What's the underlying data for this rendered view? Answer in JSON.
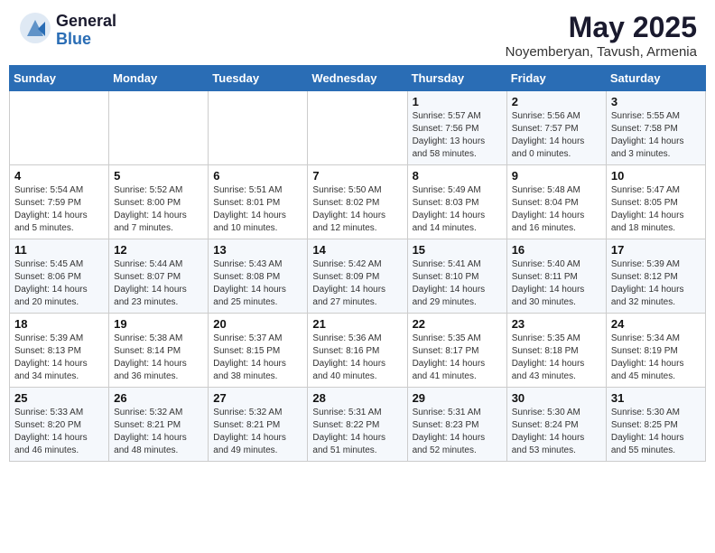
{
  "header": {
    "logo_general": "General",
    "logo_blue": "Blue",
    "title": "May 2025",
    "subtitle": "Noyemberyan, Tavush, Armenia"
  },
  "weekdays": [
    "Sunday",
    "Monday",
    "Tuesday",
    "Wednesday",
    "Thursday",
    "Friday",
    "Saturday"
  ],
  "weeks": [
    [
      {
        "day": "",
        "sunrise": "",
        "sunset": "",
        "daylight": ""
      },
      {
        "day": "",
        "sunrise": "",
        "sunset": "",
        "daylight": ""
      },
      {
        "day": "",
        "sunrise": "",
        "sunset": "",
        "daylight": ""
      },
      {
        "day": "",
        "sunrise": "",
        "sunset": "",
        "daylight": ""
      },
      {
        "day": "1",
        "sunrise": "Sunrise: 5:57 AM",
        "sunset": "Sunset: 7:56 PM",
        "daylight": "Daylight: 13 hours and 58 minutes."
      },
      {
        "day": "2",
        "sunrise": "Sunrise: 5:56 AM",
        "sunset": "Sunset: 7:57 PM",
        "daylight": "Daylight: 14 hours and 0 minutes."
      },
      {
        "day": "3",
        "sunrise": "Sunrise: 5:55 AM",
        "sunset": "Sunset: 7:58 PM",
        "daylight": "Daylight: 14 hours and 3 minutes."
      }
    ],
    [
      {
        "day": "4",
        "sunrise": "Sunrise: 5:54 AM",
        "sunset": "Sunset: 7:59 PM",
        "daylight": "Daylight: 14 hours and 5 minutes."
      },
      {
        "day": "5",
        "sunrise": "Sunrise: 5:52 AM",
        "sunset": "Sunset: 8:00 PM",
        "daylight": "Daylight: 14 hours and 7 minutes."
      },
      {
        "day": "6",
        "sunrise": "Sunrise: 5:51 AM",
        "sunset": "Sunset: 8:01 PM",
        "daylight": "Daylight: 14 hours and 10 minutes."
      },
      {
        "day": "7",
        "sunrise": "Sunrise: 5:50 AM",
        "sunset": "Sunset: 8:02 PM",
        "daylight": "Daylight: 14 hours and 12 minutes."
      },
      {
        "day": "8",
        "sunrise": "Sunrise: 5:49 AM",
        "sunset": "Sunset: 8:03 PM",
        "daylight": "Daylight: 14 hours and 14 minutes."
      },
      {
        "day": "9",
        "sunrise": "Sunrise: 5:48 AM",
        "sunset": "Sunset: 8:04 PM",
        "daylight": "Daylight: 14 hours and 16 minutes."
      },
      {
        "day": "10",
        "sunrise": "Sunrise: 5:47 AM",
        "sunset": "Sunset: 8:05 PM",
        "daylight": "Daylight: 14 hours and 18 minutes."
      }
    ],
    [
      {
        "day": "11",
        "sunrise": "Sunrise: 5:45 AM",
        "sunset": "Sunset: 8:06 PM",
        "daylight": "Daylight: 14 hours and 20 minutes."
      },
      {
        "day": "12",
        "sunrise": "Sunrise: 5:44 AM",
        "sunset": "Sunset: 8:07 PM",
        "daylight": "Daylight: 14 hours and 23 minutes."
      },
      {
        "day": "13",
        "sunrise": "Sunrise: 5:43 AM",
        "sunset": "Sunset: 8:08 PM",
        "daylight": "Daylight: 14 hours and 25 minutes."
      },
      {
        "day": "14",
        "sunrise": "Sunrise: 5:42 AM",
        "sunset": "Sunset: 8:09 PM",
        "daylight": "Daylight: 14 hours and 27 minutes."
      },
      {
        "day": "15",
        "sunrise": "Sunrise: 5:41 AM",
        "sunset": "Sunset: 8:10 PM",
        "daylight": "Daylight: 14 hours and 29 minutes."
      },
      {
        "day": "16",
        "sunrise": "Sunrise: 5:40 AM",
        "sunset": "Sunset: 8:11 PM",
        "daylight": "Daylight: 14 hours and 30 minutes."
      },
      {
        "day": "17",
        "sunrise": "Sunrise: 5:39 AM",
        "sunset": "Sunset: 8:12 PM",
        "daylight": "Daylight: 14 hours and 32 minutes."
      }
    ],
    [
      {
        "day": "18",
        "sunrise": "Sunrise: 5:39 AM",
        "sunset": "Sunset: 8:13 PM",
        "daylight": "Daylight: 14 hours and 34 minutes."
      },
      {
        "day": "19",
        "sunrise": "Sunrise: 5:38 AM",
        "sunset": "Sunset: 8:14 PM",
        "daylight": "Daylight: 14 hours and 36 minutes."
      },
      {
        "day": "20",
        "sunrise": "Sunrise: 5:37 AM",
        "sunset": "Sunset: 8:15 PM",
        "daylight": "Daylight: 14 hours and 38 minutes."
      },
      {
        "day": "21",
        "sunrise": "Sunrise: 5:36 AM",
        "sunset": "Sunset: 8:16 PM",
        "daylight": "Daylight: 14 hours and 40 minutes."
      },
      {
        "day": "22",
        "sunrise": "Sunrise: 5:35 AM",
        "sunset": "Sunset: 8:17 PM",
        "daylight": "Daylight: 14 hours and 41 minutes."
      },
      {
        "day": "23",
        "sunrise": "Sunrise: 5:35 AM",
        "sunset": "Sunset: 8:18 PM",
        "daylight": "Daylight: 14 hours and 43 minutes."
      },
      {
        "day": "24",
        "sunrise": "Sunrise: 5:34 AM",
        "sunset": "Sunset: 8:19 PM",
        "daylight": "Daylight: 14 hours and 45 minutes."
      }
    ],
    [
      {
        "day": "25",
        "sunrise": "Sunrise: 5:33 AM",
        "sunset": "Sunset: 8:20 PM",
        "daylight": "Daylight: 14 hours and 46 minutes."
      },
      {
        "day": "26",
        "sunrise": "Sunrise: 5:32 AM",
        "sunset": "Sunset: 8:21 PM",
        "daylight": "Daylight: 14 hours and 48 minutes."
      },
      {
        "day": "27",
        "sunrise": "Sunrise: 5:32 AM",
        "sunset": "Sunset: 8:21 PM",
        "daylight": "Daylight: 14 hours and 49 minutes."
      },
      {
        "day": "28",
        "sunrise": "Sunrise: 5:31 AM",
        "sunset": "Sunset: 8:22 PM",
        "daylight": "Daylight: 14 hours and 51 minutes."
      },
      {
        "day": "29",
        "sunrise": "Sunrise: 5:31 AM",
        "sunset": "Sunset: 8:23 PM",
        "daylight": "Daylight: 14 hours and 52 minutes."
      },
      {
        "day": "30",
        "sunrise": "Sunrise: 5:30 AM",
        "sunset": "Sunset: 8:24 PM",
        "daylight": "Daylight: 14 hours and 53 minutes."
      },
      {
        "day": "31",
        "sunrise": "Sunrise: 5:30 AM",
        "sunset": "Sunset: 8:25 PM",
        "daylight": "Daylight: 14 hours and 55 minutes."
      }
    ]
  ]
}
